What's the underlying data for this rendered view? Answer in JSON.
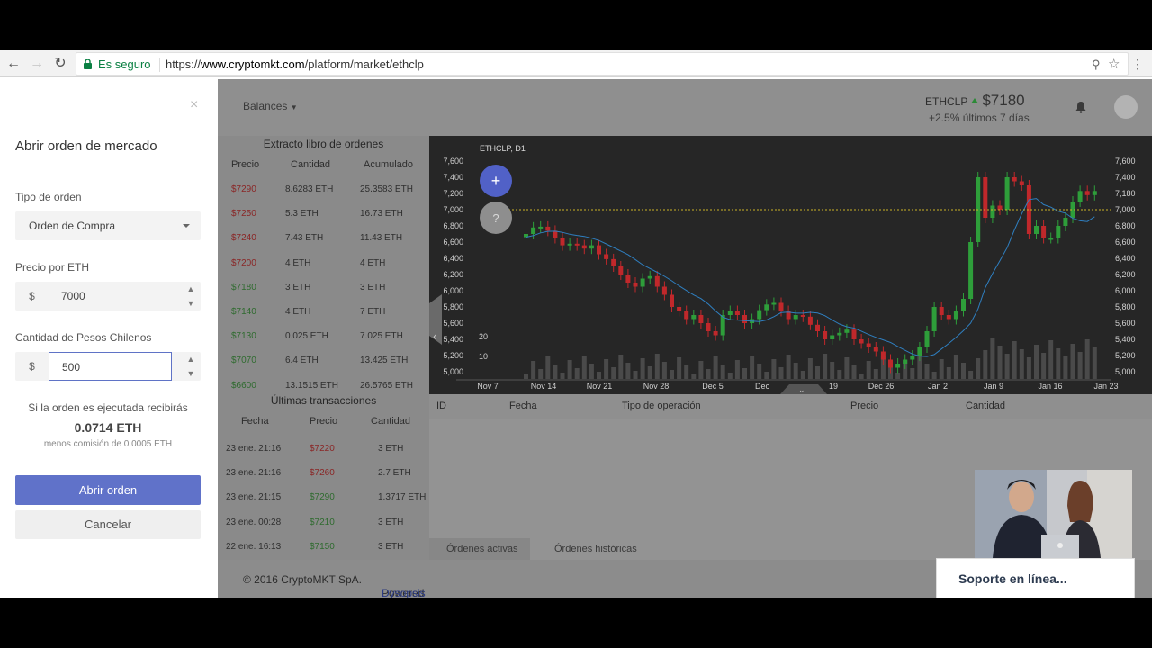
{
  "browser": {
    "secure_label": "Es seguro",
    "url_scheme": "https://",
    "url_domain": "www.cryptomkt.com",
    "url_path": "/platform/market/ethclp"
  },
  "modal": {
    "close": "×",
    "title": "Abrir orden de mercado",
    "order_type_label": "Tipo de orden",
    "order_type_value": "Orden de Compra",
    "price_label": "Precio por ETH",
    "price_prefix": "$",
    "price_value": "7000",
    "amount_label": "Cantidad de Pesos Chilenos",
    "amount_prefix": "$",
    "amount_value": "500",
    "receive_text": "Si la orden es ejecutada recibirás",
    "receive_amount": "0.0714 ETH",
    "fee_text": "menos comisión de 0.0005 ETH",
    "submit_label": "Abrir orden",
    "cancel_label": "Cancelar"
  },
  "header": {
    "balances_label": "Balances",
    "ticker_symbol": "ETHCLP",
    "ticker_price": "$7180",
    "ticker_change": "+2.5% últimos 7 días"
  },
  "order_book": {
    "title": "Extracto libro de ordenes",
    "columns": [
      "Precio",
      "Cantidad",
      "Acumulado"
    ],
    "rows": [
      {
        "price": "$7290",
        "qty": "8.6283 ETH",
        "acc": "25.3583 ETH",
        "side": "sell"
      },
      {
        "price": "$7250",
        "qty": "5.3 ETH",
        "acc": "16.73 ETH",
        "side": "sell"
      },
      {
        "price": "$7240",
        "qty": "7.43 ETH",
        "acc": "11.43 ETH",
        "side": "sell"
      },
      {
        "price": "$7200",
        "qty": "4 ETH",
        "acc": "4 ETH",
        "side": "sell"
      },
      {
        "price": "$7180",
        "qty": "3 ETH",
        "acc": "3 ETH",
        "side": "buy"
      },
      {
        "price": "$7140",
        "qty": "4 ETH",
        "acc": "7 ETH",
        "side": "buy"
      },
      {
        "price": "$7130",
        "qty": "0.025 ETH",
        "acc": "7.025 ETH",
        "side": "buy"
      },
      {
        "price": "$7070",
        "qty": "6.4 ETH",
        "acc": "13.425 ETH",
        "side": "buy"
      },
      {
        "price": "$6600",
        "qty": "13.1515 ETH",
        "acc": "26.5765 ETH",
        "side": "buy"
      }
    ]
  },
  "trades": {
    "title": "Últimas transacciones",
    "columns": [
      "Fecha",
      "Precio",
      "Cantidad"
    ],
    "rows": [
      {
        "date": "23 ene. 21:16",
        "price": "$7220",
        "qty": "3 ETH",
        "side": "sell"
      },
      {
        "date": "23 ene. 21:16",
        "price": "$7260",
        "qty": "2.7 ETH",
        "side": "sell"
      },
      {
        "date": "23 ene. 21:15",
        "price": "$7290",
        "qty": "1.3717 ETH",
        "side": "buy"
      },
      {
        "date": "23 ene. 00:28",
        "price": "$7210",
        "qty": "3 ETH",
        "side": "buy"
      },
      {
        "date": "22 ene. 16:13",
        "price": "$7150",
        "qty": "3 ETH",
        "side": "buy"
      }
    ]
  },
  "chart": {
    "label": "ETHCLP, D1",
    "add_glyph": "+",
    "help_glyph": "?",
    "y_ticks": [
      "7,600",
      "7,400",
      "7,200",
      "7,000",
      "6,800",
      "6,600",
      "6,400",
      "6,200",
      "6,000",
      "5,800",
      "5,600",
      "5,400",
      "5,200",
      "5,000"
    ],
    "right_ticks": [
      "7,600",
      "7,400",
      "7,180",
      "7,000",
      "6,800",
      "6,600",
      "6,400",
      "6,200",
      "6,000",
      "5,800",
      "5,600",
      "5,400",
      "5,200",
      "5,000"
    ],
    "volume_ticks": [
      "20",
      "10"
    ],
    "x_ticks": [
      "Nov 7",
      "Nov 14",
      "Nov 21",
      "Nov 28",
      "Dec 5",
      "Dec",
      "19",
      "Dec 26",
      "Jan 2",
      "Jan 9",
      "Jan 16",
      "Jan 23"
    ],
    "colors": {
      "up": "#2e9e3a",
      "down": "#c0282b",
      "ma": "#2f7fc0",
      "current": "#c9b226"
    }
  },
  "orders": {
    "columns": [
      "ID",
      "Fecha",
      "Tipo de operación",
      "Precio",
      "Cantidad"
    ],
    "tabs": [
      "Órdenes activas",
      "Órdenes históricas"
    ]
  },
  "footer": {
    "copyright": "© 2016 CryptoMKT SpA.",
    "powered_prefix": "Powered by",
    "powered_link": "Dysopsis"
  },
  "support": {
    "label": "Soporte en línea..."
  }
}
